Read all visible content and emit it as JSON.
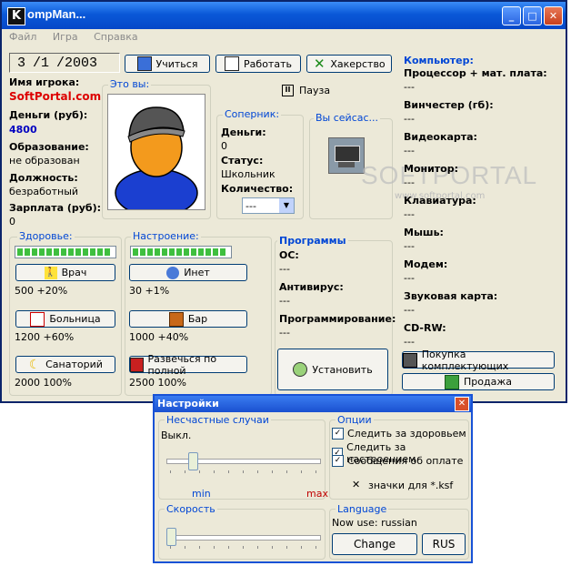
{
  "window": {
    "title": "ompMan...",
    "icon_letter": "K"
  },
  "menu": [
    "Файл",
    "Игра",
    "Справка"
  ],
  "date": {
    "day": "3",
    "month": "/1",
    "year": "/2003"
  },
  "toolbar": {
    "study": "Учиться",
    "work": "Работать",
    "hack": "Хакерство"
  },
  "player": {
    "name_label": "Имя игрока:",
    "name": "SoftPortal.com",
    "money_label": "Деньги (руб):",
    "money": "4800",
    "edu_label": "Образование:",
    "edu": "не образован",
    "job_label": "Должность:",
    "job": "безработный",
    "salary_label": "Зарплата (руб):",
    "salary": "0"
  },
  "you": {
    "title": "Это вы:"
  },
  "pause": {
    "label": "Пауза"
  },
  "rival": {
    "title": "Соперник:",
    "money_label": "Деньги:",
    "money": "0",
    "status_label": "Статус:",
    "status": "Школьник",
    "count_label": "Количество:",
    "count": "---"
  },
  "now": {
    "title": "Вы сейсас..."
  },
  "health": {
    "title": "Здоровье:",
    "level": 1.0,
    "doctor": "Врач",
    "doctor_cost": "500 +20%",
    "hospital": "Больница",
    "hospital_cost": "1200 +60%",
    "sanatorium": "Санаторий",
    "sanatorium_cost": "2000 100%"
  },
  "mood": {
    "title": "Настроение:",
    "level": 1.0,
    "inet": "Инет",
    "inet_cost": "30 +1%",
    "bar": "Бар",
    "bar_cost": "1000 +40%",
    "party": "Развечься по полной",
    "party_cost": "2500 100%"
  },
  "programs": {
    "title": "Программы",
    "os_label": "ОС:",
    "os": "---",
    "av_label": "Антивирус:",
    "av": "---",
    "prog_label": "Программирование:",
    "prog": "---",
    "install": "Установить"
  },
  "computer": {
    "title": "Компьютер:",
    "items": [
      {
        "label": "Процессор + мат. плата:",
        "value": "---"
      },
      {
        "label": "Винчестер (гб):",
        "value": "---"
      },
      {
        "label": "Видеокарта:",
        "value": "---"
      },
      {
        "label": "Монитор:",
        "value": "---"
      },
      {
        "label": "Клавиатура:",
        "value": "---"
      },
      {
        "label": "Мышь:",
        "value": "---"
      },
      {
        "label": "Модем:",
        "value": "---"
      },
      {
        "label": "Звуковая карта:",
        "value": "---"
      },
      {
        "label": "CD-RW:",
        "value": "---"
      }
    ],
    "buy": "Покупка комплектующих",
    "sell": "Продажа"
  },
  "watermark": {
    "main": "SOFTPORTAL",
    "sub": "www.softportal.com"
  },
  "settings": {
    "title": "Настройки",
    "accidents": {
      "title": "Несчастные случаи",
      "state": "Выкл.",
      "min": "min",
      "max": "max",
      "level": 0.15
    },
    "options": {
      "title": "Опции",
      "health": "Следить за здоровьем",
      "mood": "Следить за настроением",
      "pay": "Сообщения об оплате",
      "ksf": "значки для *.ksf"
    },
    "speed": {
      "title": "Скорость",
      "level": 0.0
    },
    "language": {
      "title": "Language",
      "now": "Now use:  russian",
      "change": "Change",
      "rus": "RUS"
    }
  }
}
